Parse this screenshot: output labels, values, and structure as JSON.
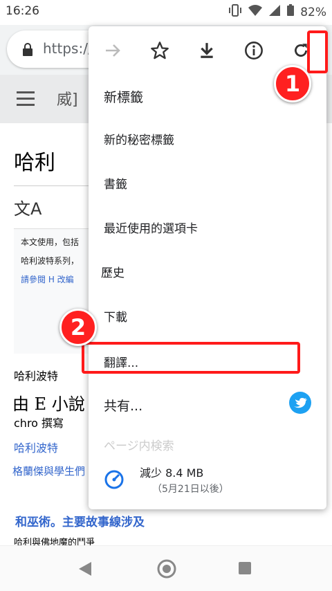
{
  "status": {
    "time": "16:26",
    "battery": "82%"
  },
  "urlbar": {
    "text": "https://"
  },
  "site": {
    "title": "威]"
  },
  "page": {
    "title": "哈利",
    "note_lines": [
      "本文使用，包括",
      "哈利波特系列，",
      "請參閱 H 改編"
    ],
    "body_label": "哈利波特",
    "heading": "由 E 小說",
    "author": "chro 撰寫",
    "link1": "哈利波特",
    "link2": "格蘭傑與學生們",
    "bold_link": "和巫術。主要故事線涉及",
    "last_line": "哈利與佛地魔的鬥爭"
  },
  "menu": {
    "toolbar_icons": [
      "forward-icon",
      "star-icon",
      "download-icon",
      "info-icon",
      "refresh-icon"
    ],
    "items": [
      "新標籤",
      "新的秘密標籤",
      "書籤",
      "最近使用的選項卡",
      "歷史",
      "下載",
      "翻譯...",
      "共有..."
    ],
    "faded_item": "ページ内検索",
    "data_saver": {
      "saved": "減少 8.4 MB",
      "since": "（5月21日以後）"
    }
  },
  "annotations": {
    "badge1": "1",
    "badge2": "2",
    "highlight_color": "#ff1a1a"
  }
}
